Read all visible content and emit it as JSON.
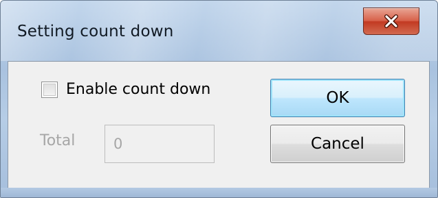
{
  "dialog": {
    "title": "Setting count down",
    "close_icon": "close-x-icon",
    "checkbox": {
      "label": "Enable count down",
      "checked": false
    },
    "total": {
      "label": "Total",
      "value": "0",
      "disabled": true
    },
    "buttons": {
      "ok_label": "OK",
      "cancel_label": "Cancel"
    }
  },
  "colors": {
    "titlebar_glass": "#b3c9e3",
    "close_button": "#c8442c",
    "client_bg": "#f0f0f0",
    "default_button_border": "#3c7fb1",
    "disabled_text": "#a6a6a6"
  }
}
